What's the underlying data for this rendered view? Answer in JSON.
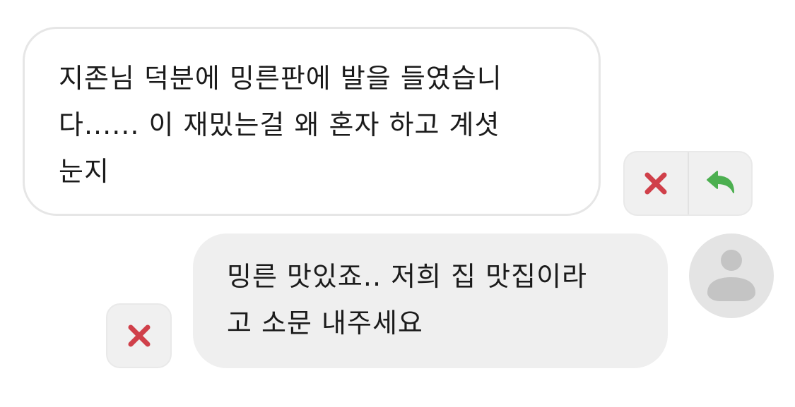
{
  "messages": {
    "received": {
      "lines": [
        "지존님 덕분에 밍른판에 발을 들였습니",
        "다...... 이 재밌는걸 왜 혼자 하고 계셧",
        "눈지"
      ],
      "actions": {
        "delete_icon": "close-x-icon",
        "reply_icon": "reply-arrow-icon"
      }
    },
    "sent": {
      "lines": [
        "밍른 맛있죠.. 저희 집 맛집이라",
        "고 소문 내주세요"
      ],
      "actions": {
        "delete_icon": "close-x-icon"
      }
    }
  },
  "colors": {
    "delete": "#d0404a",
    "reply": "#4caf50",
    "received_bubble_bg": "#ffffff",
    "received_bubble_border": "#e6e6e6",
    "sent_bubble_bg": "#efefef",
    "action_bg": "#f0f0f0",
    "avatar_bg": "#e4e4e4",
    "avatar_fg": "#c4c4c4",
    "text": "#1b1b1b"
  }
}
